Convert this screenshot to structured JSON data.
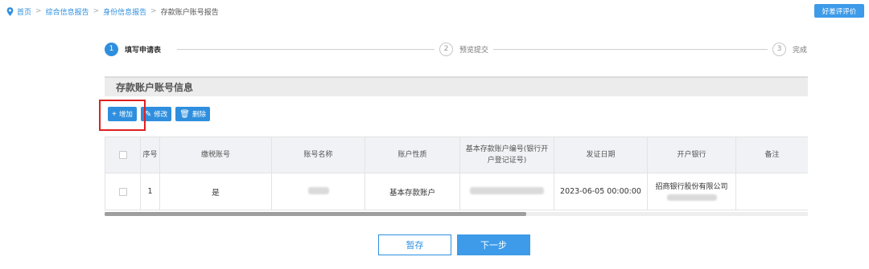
{
  "breadcrumb": {
    "items": [
      "首页",
      "综合信息报告",
      "身份信息报告"
    ],
    "current": "存款账户账号报告",
    "separator": ">"
  },
  "rate_button": "好差评评价",
  "steps": [
    {
      "number": "1",
      "label": "填写申请表"
    },
    {
      "number": "2",
      "label": "预览提交"
    },
    {
      "number": "3",
      "label": "完成"
    }
  ],
  "section_title": "存款账户账号信息",
  "toolbar": {
    "add": "增加",
    "edit": "修改",
    "delete": "删除"
  },
  "table": {
    "headers": [
      "序号",
      "缴税账号",
      "账号名称",
      "账户性质",
      "基本存款账户编号(银行开户登记证号)",
      "发证日期",
      "开户银行",
      "备注"
    ],
    "rows": [
      {
        "index": "1",
        "tax_account": "是",
        "account_name": "",
        "account_type": "基本存款账户",
        "basic_account_no": "",
        "issue_date": "2023-06-05 00:00:00",
        "bank": "招商银行股份有限公司",
        "remark": ""
      }
    ]
  },
  "buttons": {
    "save": "暂存",
    "next": "下一步"
  },
  "colors": {
    "primary": "#2f8fde",
    "highlight": "#e02020"
  }
}
